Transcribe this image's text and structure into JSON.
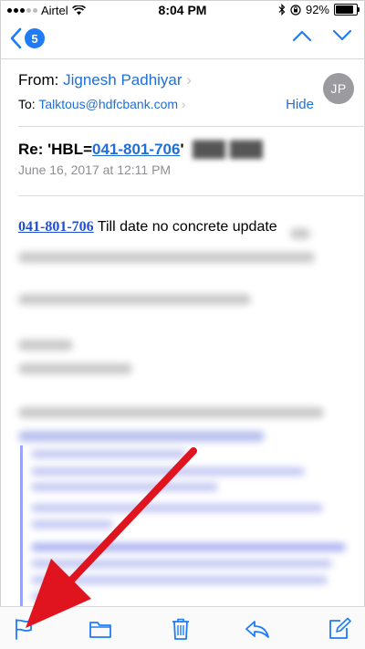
{
  "status": {
    "carrier": "Airtel",
    "time": "8:04 PM",
    "battery": "92%"
  },
  "nav": {
    "unread_count": "5"
  },
  "header": {
    "from_label": "From:",
    "from_name": "Jignesh Padhiyar",
    "to_label": "To:",
    "to_address": "Talktous@hdfcbank.com",
    "hide_label": "Hide",
    "avatar_initials": "JP"
  },
  "subject": {
    "prefix": "Re: 'HBL=",
    "number": "041-801-706",
    "suffix": "'"
  },
  "date": "June 16, 2017 at 12:11 PM",
  "body": {
    "link_number": "041-801-706",
    "text": " Till date no concrete update"
  },
  "colors": {
    "accent": "#1f7cf6",
    "link": "#1f4fd6",
    "arrow": "#e0141e"
  }
}
